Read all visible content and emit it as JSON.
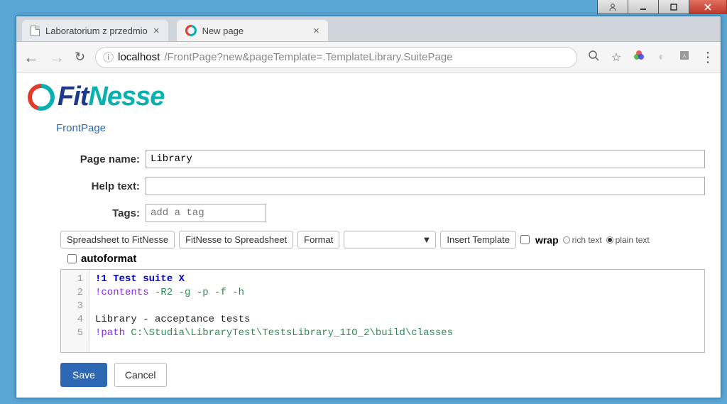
{
  "window": {
    "user_icon": "user-icon",
    "minimize": "–",
    "maximize": "❐",
    "close": "✕"
  },
  "tabs": [
    {
      "title": "Laboratorium z przedmio",
      "active": false
    },
    {
      "title": "New page",
      "active": true
    }
  ],
  "url": {
    "info": "ⓘ",
    "host": "localhost",
    "path": "/FrontPage?new&pageTemplate=.TemplateLibrary.SuitePage"
  },
  "toolbar_icons": {
    "zoom": "⊕",
    "star": "☆",
    "rgb": "●",
    "clock": "◐",
    "pdf": "⬚",
    "menu": "⋮"
  },
  "logo": {
    "fit": "Fit",
    "nesse": "Nesse"
  },
  "breadcrumb": "FrontPage",
  "form": {
    "page_name_label": "Page name:",
    "page_name_value": "Library",
    "help_text_label": "Help text:",
    "help_text_value": "",
    "tags_label": "Tags:",
    "tags_placeholder": "add a tag"
  },
  "editor_toolbar": {
    "spreadsheet_to_fitnesse": "Spreadsheet to FitNesse",
    "fitnesse_to_spreadsheet": "FitNesse to Spreadsheet",
    "format": "Format",
    "insert_template": "Insert Template",
    "select_marker": "▼",
    "wrap": "wrap",
    "rich_text": "rich text",
    "plain_text": "plain text",
    "autoformat": "autoformat"
  },
  "code": {
    "lines": [
      "1",
      "2",
      "3",
      "4",
      "5"
    ],
    "line1_a": "!1 Test suite X",
    "line2_a": "!contents",
    "line2_b": " -R2 -g -p -f -h",
    "line4": "Library - acceptance tests",
    "line5_a": "!path",
    "line5_b": " C:\\Studia\\LibraryTest\\TestsLibrary_1IO_2\\build\\classes"
  },
  "actions": {
    "save": "Save",
    "cancel": "Cancel"
  }
}
